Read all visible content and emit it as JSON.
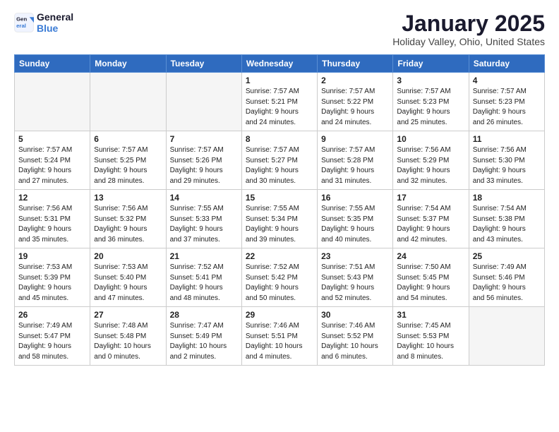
{
  "header": {
    "logo_line1": "General",
    "logo_line2": "Blue",
    "month": "January 2025",
    "location": "Holiday Valley, Ohio, United States"
  },
  "days_of_week": [
    "Sunday",
    "Monday",
    "Tuesday",
    "Wednesday",
    "Thursday",
    "Friday",
    "Saturday"
  ],
  "weeks": [
    [
      {
        "day": "",
        "info": ""
      },
      {
        "day": "",
        "info": ""
      },
      {
        "day": "",
        "info": ""
      },
      {
        "day": "1",
        "info": "Sunrise: 7:57 AM\nSunset: 5:21 PM\nDaylight: 9 hours\nand 24 minutes."
      },
      {
        "day": "2",
        "info": "Sunrise: 7:57 AM\nSunset: 5:22 PM\nDaylight: 9 hours\nand 24 minutes."
      },
      {
        "day": "3",
        "info": "Sunrise: 7:57 AM\nSunset: 5:23 PM\nDaylight: 9 hours\nand 25 minutes."
      },
      {
        "day": "4",
        "info": "Sunrise: 7:57 AM\nSunset: 5:23 PM\nDaylight: 9 hours\nand 26 minutes."
      }
    ],
    [
      {
        "day": "5",
        "info": "Sunrise: 7:57 AM\nSunset: 5:24 PM\nDaylight: 9 hours\nand 27 minutes."
      },
      {
        "day": "6",
        "info": "Sunrise: 7:57 AM\nSunset: 5:25 PM\nDaylight: 9 hours\nand 28 minutes."
      },
      {
        "day": "7",
        "info": "Sunrise: 7:57 AM\nSunset: 5:26 PM\nDaylight: 9 hours\nand 29 minutes."
      },
      {
        "day": "8",
        "info": "Sunrise: 7:57 AM\nSunset: 5:27 PM\nDaylight: 9 hours\nand 30 minutes."
      },
      {
        "day": "9",
        "info": "Sunrise: 7:57 AM\nSunset: 5:28 PM\nDaylight: 9 hours\nand 31 minutes."
      },
      {
        "day": "10",
        "info": "Sunrise: 7:56 AM\nSunset: 5:29 PM\nDaylight: 9 hours\nand 32 minutes."
      },
      {
        "day": "11",
        "info": "Sunrise: 7:56 AM\nSunset: 5:30 PM\nDaylight: 9 hours\nand 33 minutes."
      }
    ],
    [
      {
        "day": "12",
        "info": "Sunrise: 7:56 AM\nSunset: 5:31 PM\nDaylight: 9 hours\nand 35 minutes."
      },
      {
        "day": "13",
        "info": "Sunrise: 7:56 AM\nSunset: 5:32 PM\nDaylight: 9 hours\nand 36 minutes."
      },
      {
        "day": "14",
        "info": "Sunrise: 7:55 AM\nSunset: 5:33 PM\nDaylight: 9 hours\nand 37 minutes."
      },
      {
        "day": "15",
        "info": "Sunrise: 7:55 AM\nSunset: 5:34 PM\nDaylight: 9 hours\nand 39 minutes."
      },
      {
        "day": "16",
        "info": "Sunrise: 7:55 AM\nSunset: 5:35 PM\nDaylight: 9 hours\nand 40 minutes."
      },
      {
        "day": "17",
        "info": "Sunrise: 7:54 AM\nSunset: 5:37 PM\nDaylight: 9 hours\nand 42 minutes."
      },
      {
        "day": "18",
        "info": "Sunrise: 7:54 AM\nSunset: 5:38 PM\nDaylight: 9 hours\nand 43 minutes."
      }
    ],
    [
      {
        "day": "19",
        "info": "Sunrise: 7:53 AM\nSunset: 5:39 PM\nDaylight: 9 hours\nand 45 minutes."
      },
      {
        "day": "20",
        "info": "Sunrise: 7:53 AM\nSunset: 5:40 PM\nDaylight: 9 hours\nand 47 minutes."
      },
      {
        "day": "21",
        "info": "Sunrise: 7:52 AM\nSunset: 5:41 PM\nDaylight: 9 hours\nand 48 minutes."
      },
      {
        "day": "22",
        "info": "Sunrise: 7:52 AM\nSunset: 5:42 PM\nDaylight: 9 hours\nand 50 minutes."
      },
      {
        "day": "23",
        "info": "Sunrise: 7:51 AM\nSunset: 5:43 PM\nDaylight: 9 hours\nand 52 minutes."
      },
      {
        "day": "24",
        "info": "Sunrise: 7:50 AM\nSunset: 5:45 PM\nDaylight: 9 hours\nand 54 minutes."
      },
      {
        "day": "25",
        "info": "Sunrise: 7:49 AM\nSunset: 5:46 PM\nDaylight: 9 hours\nand 56 minutes."
      }
    ],
    [
      {
        "day": "26",
        "info": "Sunrise: 7:49 AM\nSunset: 5:47 PM\nDaylight: 9 hours\nand 58 minutes."
      },
      {
        "day": "27",
        "info": "Sunrise: 7:48 AM\nSunset: 5:48 PM\nDaylight: 10 hours\nand 0 minutes."
      },
      {
        "day": "28",
        "info": "Sunrise: 7:47 AM\nSunset: 5:49 PM\nDaylight: 10 hours\nand 2 minutes."
      },
      {
        "day": "29",
        "info": "Sunrise: 7:46 AM\nSunset: 5:51 PM\nDaylight: 10 hours\nand 4 minutes."
      },
      {
        "day": "30",
        "info": "Sunrise: 7:46 AM\nSunset: 5:52 PM\nDaylight: 10 hours\nand 6 minutes."
      },
      {
        "day": "31",
        "info": "Sunrise: 7:45 AM\nSunset: 5:53 PM\nDaylight: 10 hours\nand 8 minutes."
      },
      {
        "day": "",
        "info": ""
      }
    ]
  ]
}
